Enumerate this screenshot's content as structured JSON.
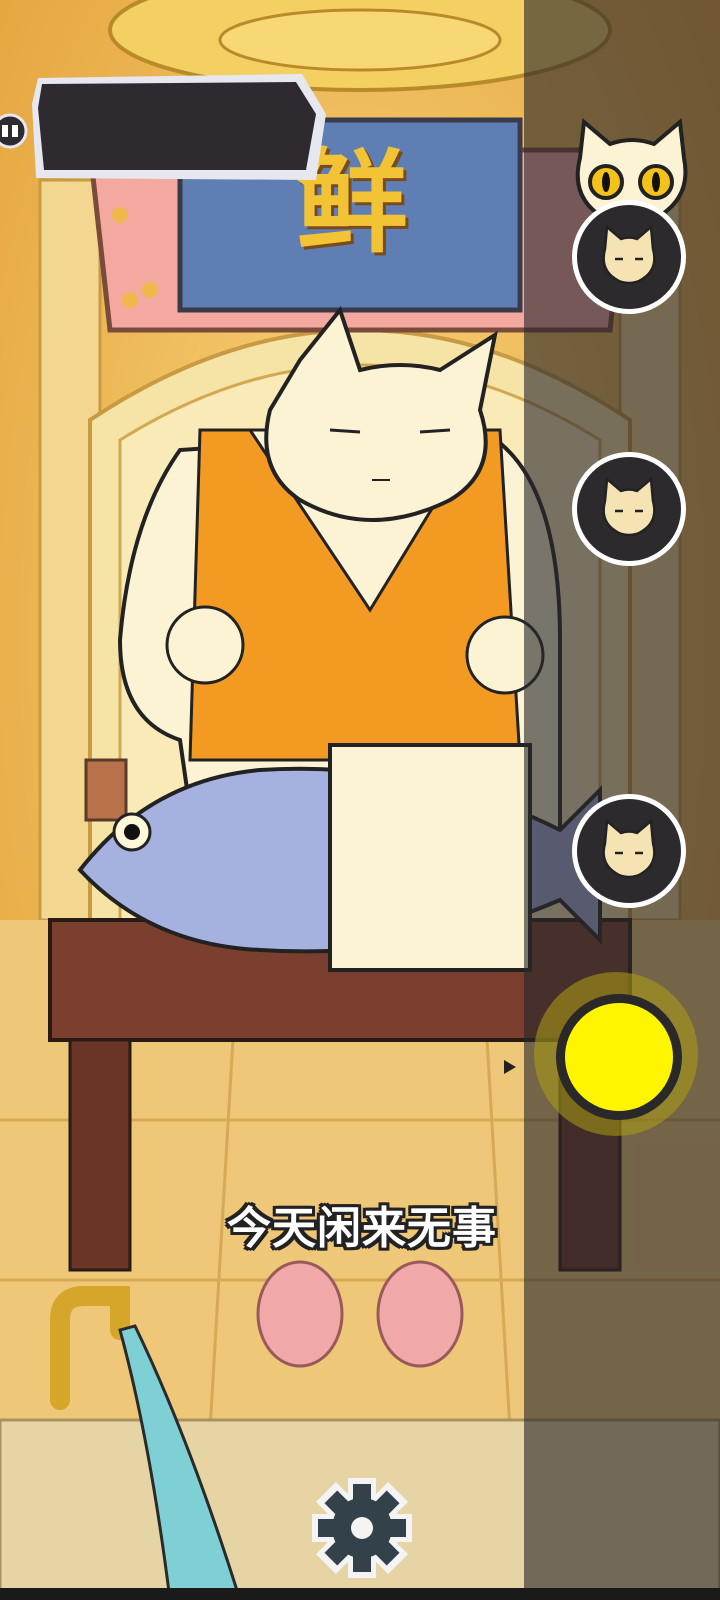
{
  "scene": {
    "shop_sign_char": "鲜",
    "subtitle": "今天闲来无事"
  },
  "hud": {
    "title_banner_text": "",
    "character_buttons": [
      {
        "icon": "sleepy-cat-face-icon"
      },
      {
        "icon": "sleepy-cat-face-icon"
      },
      {
        "icon": "sleepy-cat-face-icon"
      }
    ],
    "top_avatar_icon": "surprised-cat-icon",
    "record_button_color": "#fff500",
    "settings_icon": "gear-icon"
  },
  "colors": {
    "background": "#e9b24a",
    "panel_overlay": "#28262c",
    "accent_yellow": "#fff500",
    "vest_orange": "#f29a22"
  }
}
